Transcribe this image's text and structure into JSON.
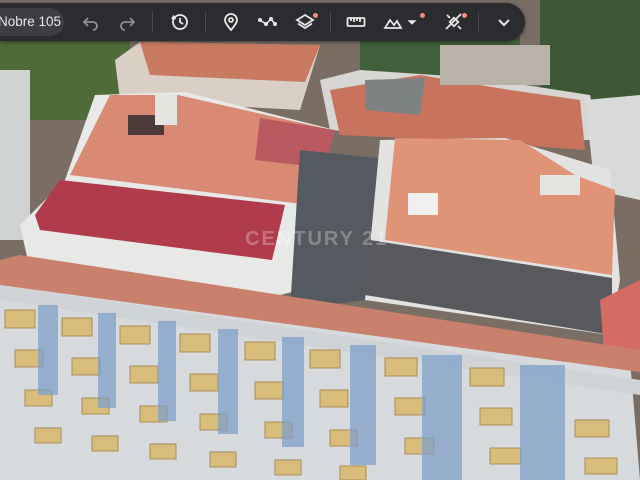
{
  "toolbar": {
    "title": "Nobre 105",
    "accent_dot_color": "#f28b82",
    "icons": [
      "undo-icon",
      "redo-icon",
      "history-icon",
      "location-pin-icon",
      "path-icon",
      "layers-icon",
      "ruler-icon",
      "terrain-icon",
      "dropdown-caret-icon",
      "satellite-icon",
      "chevron-down-icon"
    ]
  },
  "map": {
    "watermark": "CENTURY 21"
  }
}
